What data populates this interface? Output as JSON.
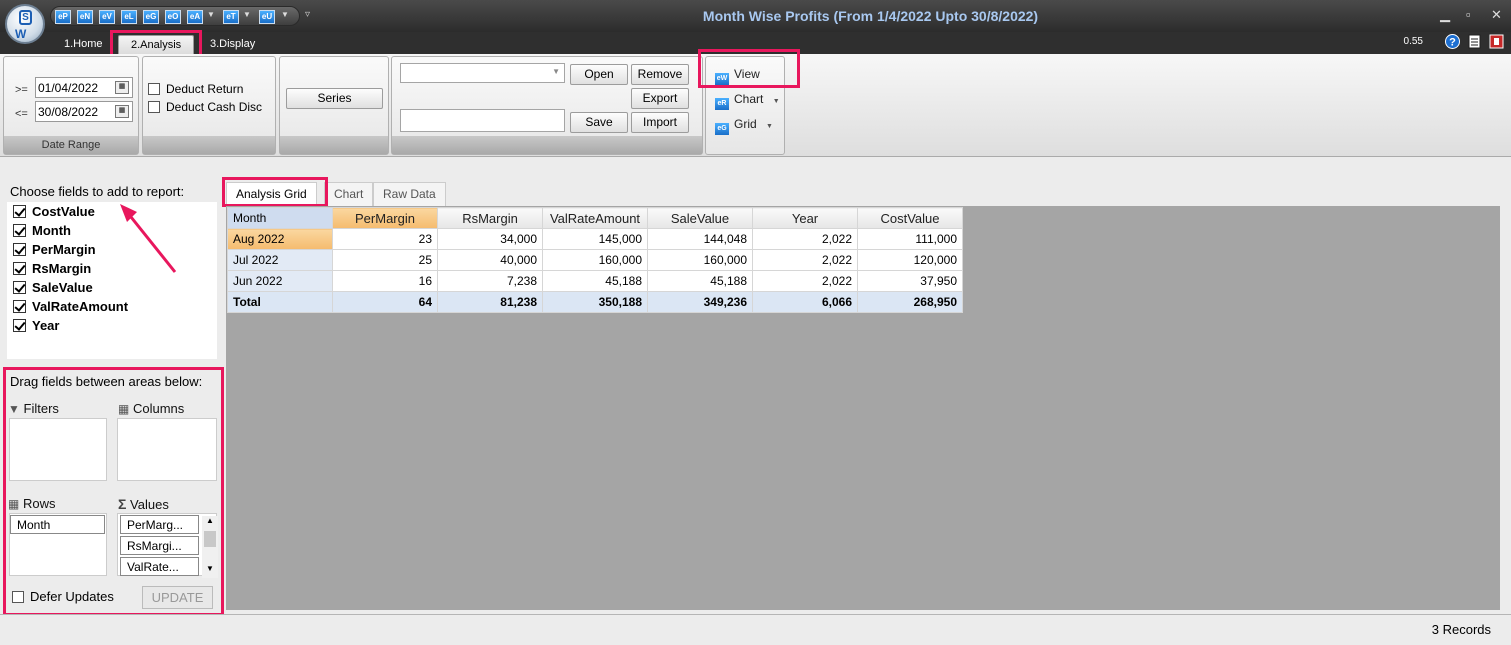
{
  "window": {
    "title": "Month Wise Profits (From 1/4/2022 Upto 30/8/2022)",
    "qat_buttons": [
      "eP",
      "eN",
      "eV",
      "eL",
      "eG",
      "eO",
      "eA",
      "eT",
      "eU"
    ],
    "logo_letters": [
      "S",
      "W"
    ]
  },
  "ribbon_tabs": [
    "1.Home",
    "2.Analysis",
    "3.Display"
  ],
  "zoom": "0.55",
  "date_range": {
    "from_op": ">=",
    "from_value": "01/04/2022",
    "to_op": "<=",
    "to_value": "30/08/2022",
    "group_label": "Date Range"
  },
  "options": {
    "deduct_return": "Deduct Return",
    "deduct_cash_disc": "Deduct Cash Disc"
  },
  "series_button": "Series",
  "layout_buttons": {
    "open": "Open",
    "remove": "Remove",
    "export": "Export",
    "save": "Save",
    "import": "Import"
  },
  "view_group": {
    "view": "View",
    "chart": "Chart",
    "grid": "Grid",
    "view_icon": "eW",
    "chart_icon": "eR",
    "grid_icon": "eG"
  },
  "field_panel": {
    "title": "Choose fields to add to report:",
    "fields": [
      "CostValue",
      "Month",
      "PerMargin",
      "RsMargin",
      "SaleValue",
      "ValRateAmount",
      "Year"
    ],
    "drag_title": "Drag fields between areas below:",
    "filters_label": "Filters",
    "columns_label": "Columns",
    "rows_label": "Rows",
    "values_label": "Values",
    "rows_items": [
      "Month"
    ],
    "values_items": [
      "PerMarg...",
      "RsMargi...",
      "ValRate..."
    ],
    "defer_label": "Defer Updates",
    "update_label": "UPDATE"
  },
  "content_tabs": [
    "Analysis Grid",
    "Chart",
    "Raw Data"
  ],
  "grid": {
    "columns": [
      "Month",
      "PerMargin",
      "RsMargin",
      "ValRateAmount",
      "SaleValue",
      "Year",
      "CostValue"
    ],
    "rows": [
      [
        "Aug 2022",
        "23",
        "34,000",
        "145,000",
        "144,048",
        "2,022",
        "111,000"
      ],
      [
        "Jul 2022",
        "25",
        "40,000",
        "160,000",
        "160,000",
        "2,022",
        "120,000"
      ],
      [
        "Jun 2022",
        "16",
        "7,238",
        "45,188",
        "45,188",
        "2,022",
        "37,950"
      ]
    ],
    "total": [
      "Total",
      "64",
      "81,238",
      "350,188",
      "349,236",
      "6,066",
      "268,950"
    ]
  },
  "status": {
    "records": "3 Records"
  },
  "colors": {
    "highlight_box": "#e8175d",
    "header_highlight": "#f5bb6e",
    "title_text": "#a8c8f0"
  }
}
